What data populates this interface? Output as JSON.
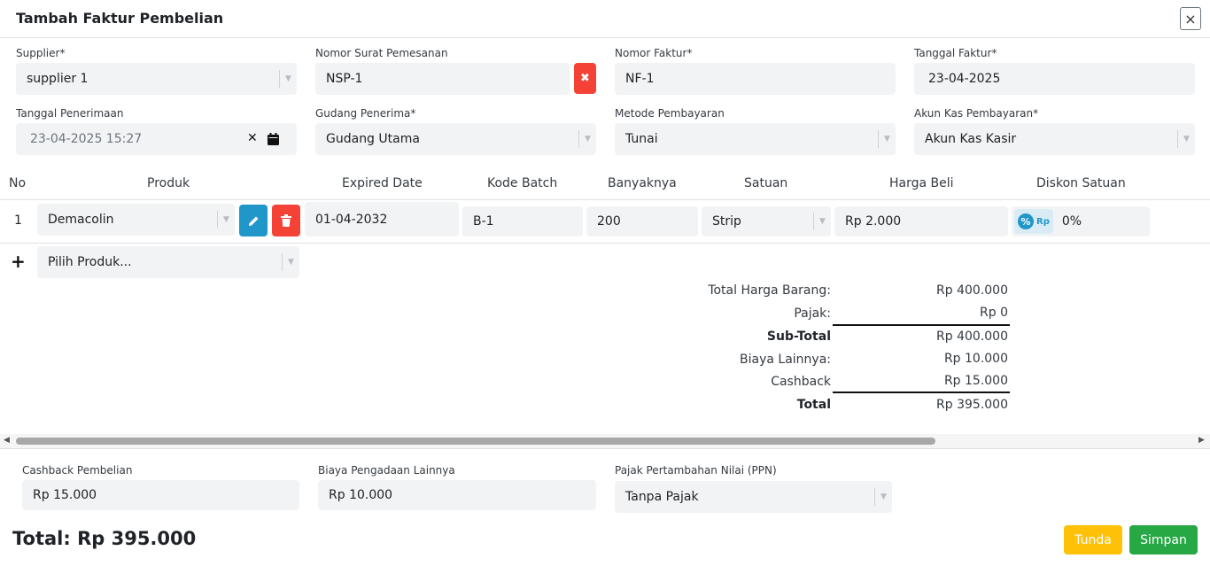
{
  "header": {
    "title": "Tambah Faktur Pembelian",
    "close_icon": "×"
  },
  "form": {
    "supplier": {
      "label": "Supplier*",
      "value": "supplier 1"
    },
    "nomor_surat": {
      "label": "Nomor Surat Pemesanan",
      "value": "NSP-1"
    },
    "nomor_faktur": {
      "label": "Nomor Faktur*",
      "value": "NF-1"
    },
    "tanggal_faktur": {
      "label": "Tanggal Faktur*",
      "value": "23-04-2025"
    },
    "tanggal_penerimaan": {
      "label": "Tanggal Penerimaan",
      "value": "23-04-2025 15:27"
    },
    "gudang": {
      "label": "Gudang Penerima*",
      "value": "Gudang Utama"
    },
    "metode": {
      "label": "Metode Pembayaran",
      "value": "Tunai"
    },
    "akun_kas": {
      "label": "Akun Kas Pembayaran*",
      "value": "Akun Kas Kasir"
    }
  },
  "table": {
    "headers": {
      "no": "No",
      "produk": "Produk",
      "expired": "Expired Date",
      "batch": "Kode Batch",
      "qty": "Banyaknya",
      "satuan": "Satuan",
      "harga": "Harga Beli",
      "diskon": "Diskon Satuan"
    },
    "rows": [
      {
        "no": "1",
        "produk": "Demacolin",
        "expired": "01-04-2032",
        "batch": "B-1",
        "qty": "200",
        "satuan": "Strip",
        "harga": "Rp 2.000",
        "diskon": "0%"
      }
    ],
    "add_row": {
      "plus": "+",
      "placeholder": "Pilih Produk..."
    },
    "discount_badge": {
      "percent": "%",
      "rp": "Rp"
    }
  },
  "summary": {
    "total_harga_label": "Total Harga Barang:",
    "total_harga_value": "Rp 400.000",
    "pajak_label": "Pajak:",
    "pajak_value": "Rp 0",
    "subtotal_label": "Sub-Total",
    "subtotal_value": "Rp 400.000",
    "biaya_label": "Biaya Lainnya:",
    "biaya_value": "Rp 10.000",
    "cashback_label": "Cashback",
    "cashback_value": "Rp 15.000",
    "total_label": "Total",
    "total_value": "Rp 395.000"
  },
  "footer": {
    "cashback": {
      "label": "Cashback Pembelian",
      "value": "Rp 15.000"
    },
    "biaya": {
      "label": "Biaya Pengadaan Lainnya",
      "value": "Rp 10.000"
    },
    "ppn": {
      "label": "Pajak Pertambahan Nilai (PPN)",
      "value": "Tanpa Pajak"
    },
    "total_text": "Total: Rp 395.000",
    "tunda": "Tunda",
    "simpan": "Simpan"
  },
  "colors": {
    "red": "#f44336",
    "blue": "#2196c9",
    "yellow": "#ffc107",
    "green": "#28a745"
  }
}
